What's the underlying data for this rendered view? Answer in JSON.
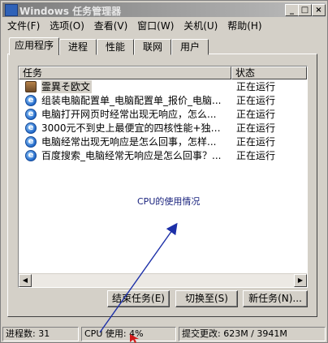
{
  "window": {
    "title": "Windows 任务管理器",
    "buttons": [
      "_",
      "□",
      "×"
    ]
  },
  "menu": [
    "文件(F)",
    "选项(O)",
    "查看(V)",
    "窗口(W)",
    "关机(U)",
    "帮助(H)"
  ],
  "tabs": [
    "应用程序",
    "进程",
    "性能",
    "联网",
    "用户"
  ],
  "table": {
    "headers": [
      "任务",
      "状态"
    ],
    "rows": [
      {
        "icon": "folder-icon",
        "name": "霊異そ欧文",
        "status": "正在运行"
      },
      {
        "icon": "ie-icon",
        "name": "组装电脑配置单_电脑配置单_报价_电脑...",
        "status": "正在运行"
      },
      {
        "icon": "ie-icon",
        "name": "电脑打开网页时经常出现无响应，怎么...",
        "status": "正在运行"
      },
      {
        "icon": "ie-icon",
        "name": "3000元不到史上最便宜的四核性能+独显...",
        "status": "正在运行"
      },
      {
        "icon": "ie-icon",
        "name": "电脑经常出现无响应是怎么回事，怎样...",
        "status": "正在运行"
      },
      {
        "icon": "ie-icon",
        "name": "百度搜索_电脑经常无响应是怎么回事？...",
        "status": "正在运行"
      }
    ]
  },
  "annotation": "CPU的使用情况",
  "buttons": {
    "end_task": "结束任务(E)",
    "switch_to": "切换至(S)",
    "new_task": "新任务(N)..."
  },
  "statusbar": {
    "processes": "进程数: 31",
    "cpu": "CPU 使用: 4%",
    "commit": "提交更改: 623M / 3941M"
  },
  "colors": {
    "arrow": "#1c2fa8",
    "pointer": "#d11a1a"
  }
}
